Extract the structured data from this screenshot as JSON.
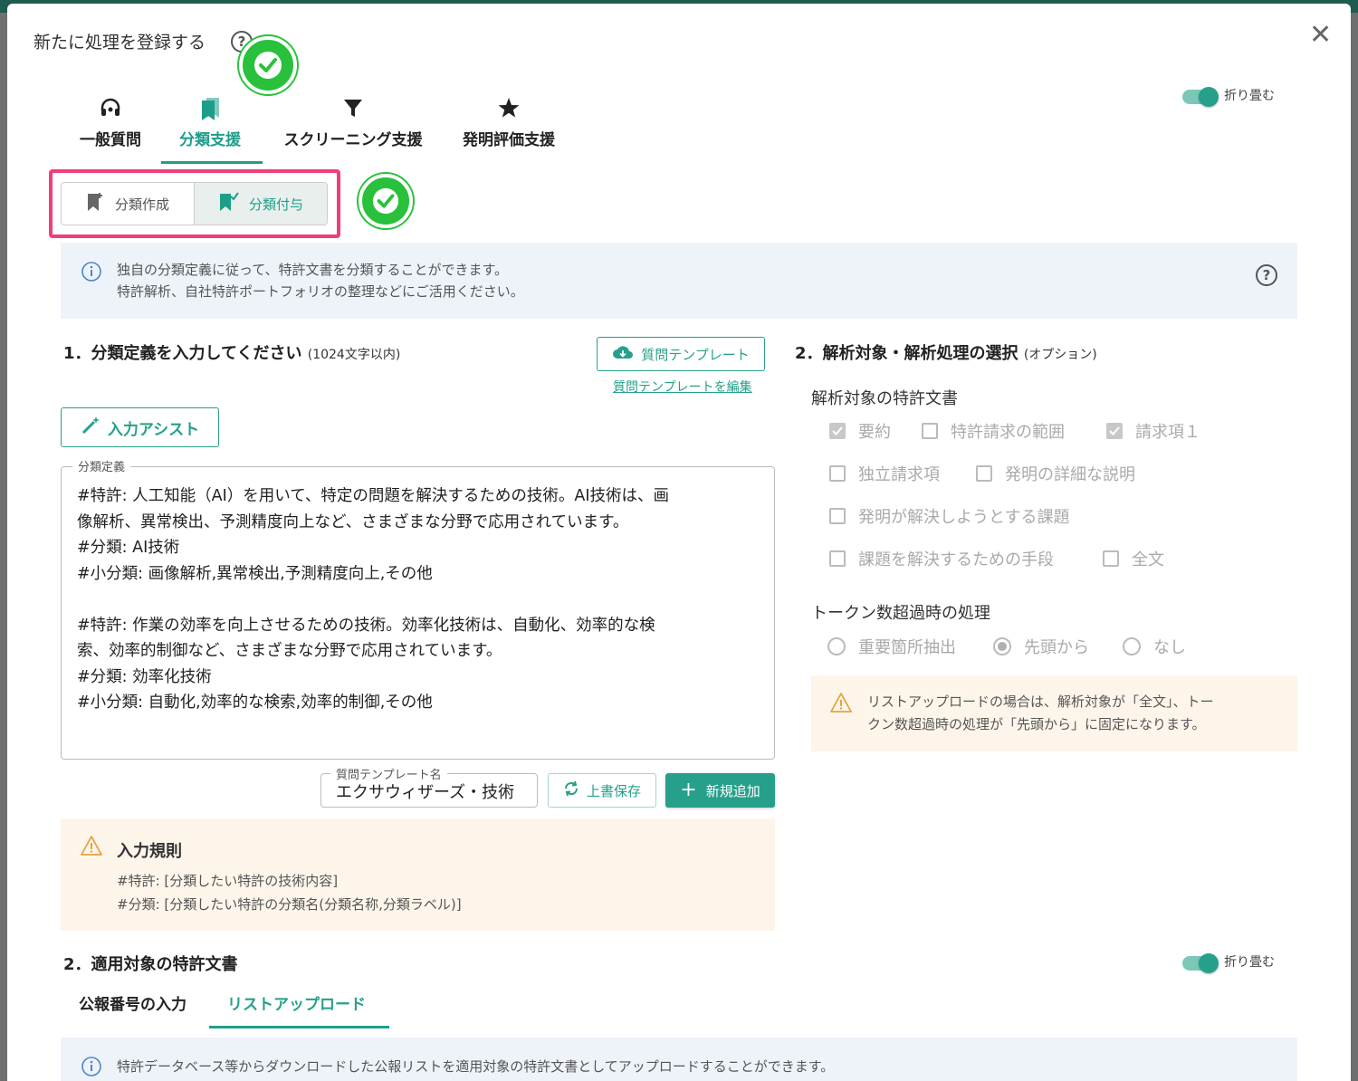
{
  "dialog": {
    "title": "新たに処理を登録する",
    "help_glyph": "?",
    "close_glyph": "✕",
    "collapse_label": "折り畳む"
  },
  "tabs": [
    {
      "label": "一般質問",
      "icon": "headset-icon"
    },
    {
      "label": "分類支援",
      "icon": "bookmark-icon",
      "active": true
    },
    {
      "label": "スクリーニング支援",
      "icon": "filter-icon"
    },
    {
      "label": "発明評価支援",
      "icon": "star-icon"
    }
  ],
  "subtabs": [
    {
      "label": "分類作成",
      "icon": "bookmark-plus-icon"
    },
    {
      "label": "分類付与",
      "icon": "bookmark-check-icon",
      "active": true
    }
  ],
  "info": {
    "line1": "独自の分類定義に従って、特許文書を分類することができます。",
    "line2": "特許解析、自社特許ポートフォリオの整理などにご活用ください。"
  },
  "section1": {
    "title": "1．分類定義を入力してください",
    "hint": "(1024文字以内)",
    "template_button": "質問テンプレート",
    "edit_template_link": "質問テンプレートを編集",
    "assist_button": "入力アシスト",
    "field_legend": "分類定義",
    "field_value": "#特許: 人工知能（AI）を用いて、特定の問題を解決するための技術。AI技術は、画\n像解析、異常検出、予測精度向上など、さまざまな分野で応用されています。\n#分類: AI技術\n#小分類: 画像解析,異常検出,予測精度向上,その他\n\n#特許: 作業の効率を向上させるための技術。効率化技術は、自動化、効率的な検\n索、効率的制御など、さまざまな分野で応用されています。\n#分類: 効率化技術\n#小分類: 自動化,効率的な検索,効率的制御,その他",
    "template_name_legend": "質問テンプレート名",
    "template_name_value": "エクサウィザーズ・技術",
    "overwrite_button": "上書保存",
    "new_button": "新規追加"
  },
  "rules": {
    "title": "入力規則",
    "line1": "#特許: [分類したい特許の技術内容]",
    "line2": "#分類: [分類したい特許の分類名(分類名称,分類ラベル)]"
  },
  "section2": {
    "title": "2．解析対象・解析処理の選択",
    "hint": "(オプション)",
    "targets_title": "解析対象の特許文書",
    "targets": [
      {
        "label": "要約",
        "checked": true
      },
      {
        "label": "特許請求の範囲",
        "checked": false
      },
      {
        "label": "請求項１",
        "checked": true
      },
      {
        "label": "独立請求項",
        "checked": false
      },
      {
        "label": "発明の詳細な説明",
        "checked": false
      },
      {
        "label": "発明が解決しようとする課題",
        "checked": false
      },
      {
        "label": "課題を解決するための手段",
        "checked": false
      },
      {
        "label": "全文",
        "checked": false
      }
    ],
    "token_title": "トークン数超過時の処理",
    "token_options": [
      {
        "label": "重要箇所抽出",
        "checked": false
      },
      {
        "label": "先頭から",
        "checked": true
      },
      {
        "label": "なし",
        "checked": false
      }
    ],
    "warning_line1": "リストアップロードの場合は、解析対象が「全文」、トー",
    "warning_line2": "クン数超過時の処理が「先頭から」に固定になります。"
  },
  "section3": {
    "title": "2．適用対象の特許文書",
    "collapse_label": "折り畳む",
    "tabs": [
      {
        "label": "公報番号の入力"
      },
      {
        "label": "リストアップロード",
        "active": true
      }
    ],
    "info": "特許データベース等からダウンロードした公報リストを適用対象の特許文書としてアップロードすることができます。"
  },
  "colors": {
    "accent": "#26a08a",
    "highlight": "#ef3f7a",
    "check_badge": "#29c13b"
  }
}
